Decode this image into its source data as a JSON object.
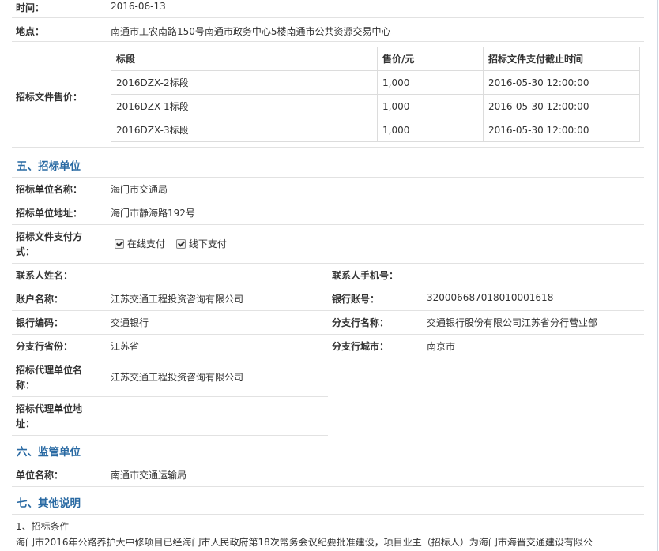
{
  "time": {
    "label": "时间：",
    "value": "2016-06-13"
  },
  "place": {
    "label": "地点：",
    "value": "南通市工农南路150号南通市政务中心5楼南通市公共资源交易中心"
  },
  "doc_price": {
    "label": "招标文件售价：",
    "headers": [
      "标段",
      "售价/元",
      "招标文件支付截止时间"
    ],
    "rows": [
      [
        "2016DZX-2标段",
        "1,000",
        "2016-05-30 12:00:00"
      ],
      [
        "2016DZX-1标段",
        "1,000",
        "2016-05-30 12:00:00"
      ],
      [
        "2016DZX-3标段",
        "1,000",
        "2016-05-30 12:00:00"
      ]
    ]
  },
  "section5": {
    "title": "五、招标单位"
  },
  "tenderer": {
    "name_label": "招标单位名称：",
    "name": "海门市交通局",
    "address_label": "招标单位地址：",
    "address": "海门市静海路192号",
    "pay_label": "招标文件支付方式：",
    "pay_options": [
      "在线支付",
      "线下支付"
    ],
    "contact_label": "联系人姓名：",
    "contact": "",
    "phone_label": "联系人手机号：",
    "phone": "",
    "account_label": "账户名称：",
    "account": "江苏交通工程投资咨询有限公司",
    "bank_no_label": "银行账号：",
    "bank_no": "32000668701801000161​8",
    "bank_code_label": "银行编码：",
    "bank_code": "交通银行",
    "branch_label": "分支行名称：",
    "branch": "交通银行股份有限公司江苏省分行营业部",
    "province_label": "分支行省份：",
    "province": "江苏省",
    "city_label": "分支行城市：",
    "city": "南京市",
    "agent_label": "招标代理单位名称：",
    "agent": "江苏交通工程投资咨询有限公司",
    "agent_addr_label": "招标代理单位地址：",
    "agent_addr": ""
  },
  "section6": {
    "title": "六、监管单位"
  },
  "supervisor": {
    "label": "单位名称：",
    "value": "南通市交通运输局"
  },
  "section7": {
    "title": "七、其他说明"
  },
  "notes": {
    "line1": "1、招标条件",
    "line2": "海门市2016年公路养护大中修项目已经海门市人民政府第18次常务会议纪要批准建设，项目业主（招标人）为海门市海晋交通建设有限公"
  }
}
